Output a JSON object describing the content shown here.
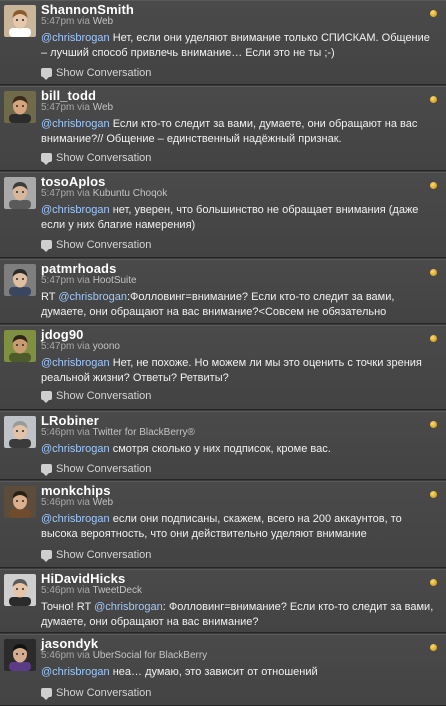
{
  "show_conversation_label": "Show Conversation",
  "tweets": [
    {
      "username": "ShannonSmith",
      "time": "5:47pm via ",
      "source": "Web",
      "parts": [
        {
          "m": "@chrisbrogan"
        },
        {
          "t": " Нет, если они уделяют внимание только СПИСКАМ. Общение – лучший способ привлечь внимание… Если это не ты ;-)"
        }
      ]
    },
    {
      "username": "bill_todd",
      "time": "5:47pm via ",
      "source": "Web",
      "parts": [
        {
          "m": "@chrisbrogan"
        },
        {
          "t": " Если кто-то следит за вами, думаете, они обращают на вас внимание?// Общение – единственный надёжный признак."
        }
      ]
    },
    {
      "username": "tosoAplos",
      "time": "5:47pm via ",
      "source": "Kubuntu Choqok",
      "parts": [
        {
          "m": "@chrisbrogan"
        },
        {
          "t": " нет, уверен, что большинство не обращает внимания (даже если у них благие намерения)"
        }
      ]
    },
    {
      "username": "patmrhoads",
      "time": "5:47pm via ",
      "source": "HootSuite",
      "parts": [
        {
          "t": "RT "
        },
        {
          "m": "@chrisbrogan"
        },
        {
          "t": ":Фолловинг=внимание? Если кто-то следит за вами, думаете, они обращают на вас внимание?<Совсем не обязательно"
        }
      ]
    },
    {
      "username": "jdog90",
      "time": "5:47pm via ",
      "source": "yoono",
      "parts": [
        {
          "m": "@chrisbrogan"
        },
        {
          "t": " Нет, не похоже. Но можем ли мы это оценить с точки зрения реальной жизни? Ответы? Ретвиты?"
        }
      ]
    },
    {
      "username": "LRobiner",
      "time": "5:46pm via ",
      "source": "Twitter for BlackBerry®",
      "parts": [
        {
          "m": "@chrisbrogan"
        },
        {
          "t": " смотря сколько у них подписок, кроме вас."
        }
      ]
    },
    {
      "username": "monkchips",
      "time": "5:46pm via ",
      "source": "Web",
      "parts": [
        {
          "m": "@chrisbrogan"
        },
        {
          "t": " если они подписаны, скажем, всего на 200 аккаунтов, то высока вероятность, что они действительно уделяют внимание"
        }
      ]
    },
    {
      "username": "HiDavidHicks",
      "time": "5:46pm via ",
      "source": "TweetDeck",
      "parts": [
        {
          "t": "Точно! RT "
        },
        {
          "m": "@chrisbrogan"
        },
        {
          "t": ": Фолловинг=внимание? Если кто-то следит за вами, думаете, они обращают на вас внимание?"
        }
      ]
    },
    {
      "username": "jasondyk",
      "time": "5:46pm via ",
      "source": "UberSocial for BlackBerry",
      "parts": [
        {
          "m": "@chrisbrogan"
        },
        {
          "t": " неа… думаю, это зависит от отношений"
        }
      ]
    }
  ],
  "avatars": [
    {
      "bg": "#c9b59a",
      "face": "#e6c9ac",
      "hair": "#8a5a2b",
      "shirt": "#ffffff"
    },
    {
      "bg": "#6e6a4a",
      "face": "#d6a57f",
      "hair": "#3a2a1c",
      "shirt": "#2c2c2c"
    },
    {
      "bg": "#a9a9a9",
      "face": "#d8b79a",
      "hair": "#3c3c3c",
      "shirt": "#5a5a5a"
    },
    {
      "bg": "#7e7e7e",
      "face": "#e0bfa0",
      "hair": "#2a2a2a",
      "shirt": "#3a4660"
    },
    {
      "bg": "#7f9140",
      "face": "#c99b73",
      "hair": "#2e2418",
      "shirt": "#4d5b2a"
    },
    {
      "bg": "#bfc2c6",
      "face": "#e2c3a8",
      "hair": "#9a9a9a",
      "shirt": "#3b3b3b"
    },
    {
      "bg": "#5b4c3c",
      "face": "#dcae8c",
      "hair": "#2a1e14",
      "shirt": "#704b2d"
    },
    {
      "bg": "#cfcfcf",
      "face": "#e6c6a6",
      "hair": "#5a5a5a",
      "shirt": "#2b2b2b"
    },
    {
      "bg": "#2b2b2b",
      "face": "#d7ad8f",
      "hair": "#121212",
      "shirt": "#5b3a86"
    }
  ]
}
